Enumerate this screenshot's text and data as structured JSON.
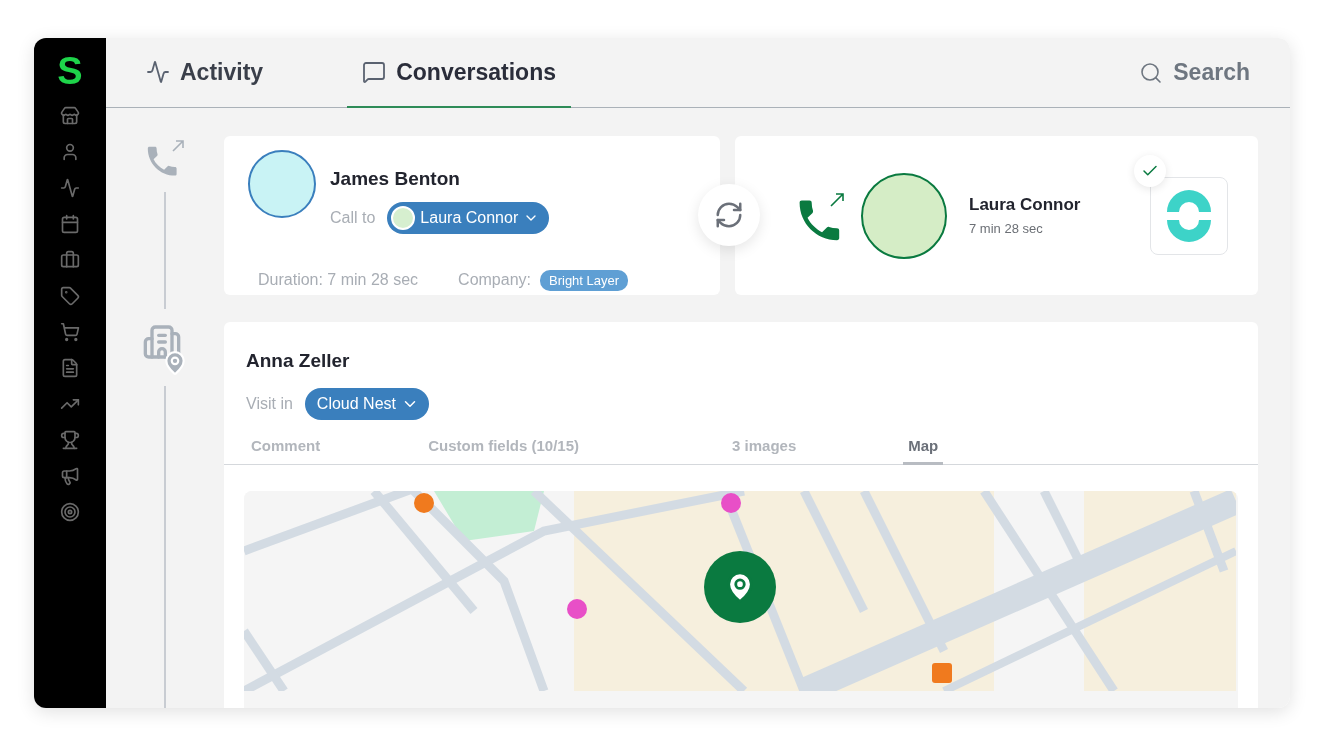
{
  "logo": "S",
  "tabs": [
    {
      "label": "Activity",
      "selected": false
    },
    {
      "label": "Conversations",
      "selected": true
    }
  ],
  "search": {
    "label": "Search"
  },
  "call": {
    "caller": "James Benton",
    "call_to_label": "Call to",
    "callee": "Laura Connor",
    "duration": "Duration: 7 min 28 sec",
    "company_label": "Company:",
    "company": "Bright Layer"
  },
  "transfer": {
    "name": "Laura Connor",
    "duration": "7 min 28 sec",
    "checked": true
  },
  "visit": {
    "name": "Anna Zeller",
    "visit_label": "Visit in",
    "place": "Cloud Nest",
    "tabs": [
      {
        "label": "Comment",
        "selected": false
      },
      {
        "label": "Custom fields (10/15)",
        "selected": false
      },
      {
        "label": "3 images",
        "selected": false
      },
      {
        "label": "Map",
        "selected": true
      }
    ]
  }
}
